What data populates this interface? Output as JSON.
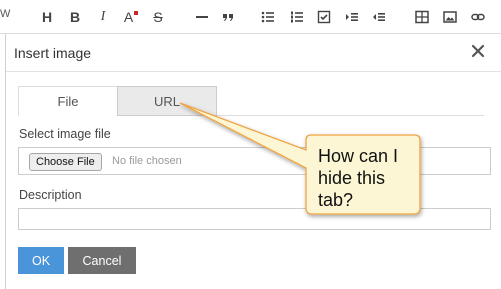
{
  "toolbar": {
    "left_fragment": "W",
    "buttons": [
      {
        "name": "heading-button",
        "glyph": "H"
      },
      {
        "name": "bold-button",
        "glyph": "B"
      },
      {
        "name": "italic-button",
        "glyph": "I"
      },
      {
        "name": "text-color-button",
        "glyph": "A"
      },
      {
        "name": "strikethrough-button",
        "glyph": "S"
      }
    ]
  },
  "dialog": {
    "title": "Insert image",
    "close_glyph": "✕",
    "tabs": [
      {
        "label": "File",
        "active": true
      },
      {
        "label": "URL",
        "active": false
      }
    ],
    "file_label": "Select image file",
    "choose_file_label": "Choose File",
    "no_file_text": "No file chosen",
    "description_label": "Description",
    "description_value": "",
    "ok_label": "OK",
    "cancel_label": "Cancel"
  },
  "callout": {
    "text": "How can I hide this tab?"
  },
  "colors": {
    "ok_button": "#4a95da",
    "cancel_button": "#6f6f6f",
    "callout_fill": "#fdf6d4",
    "callout_border": "#f0a443",
    "text_color_marker": "#c62828"
  }
}
